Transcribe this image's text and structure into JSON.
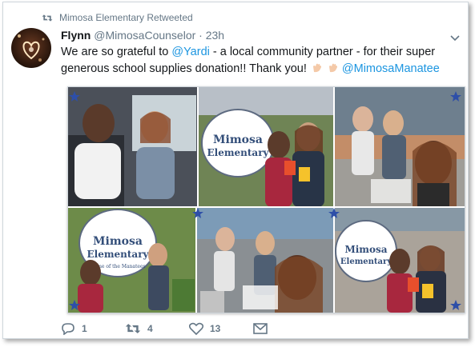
{
  "retweet": {
    "text": "Mimosa Elementary Retweeted"
  },
  "tweet": {
    "author_name": "Flynn",
    "author_handle": "@MimosaCounselor",
    "dot": "·",
    "time": "23h",
    "text_part1": "We are so grateful to ",
    "mention1": "@Yardi",
    "text_part2": " - a local community partner - for their super generous school supplies donation!! Thank you! ",
    "mention2": "@MimosaManatee"
  },
  "collage": {
    "sign_line1": "Mimosa",
    "sign_line2": "Elementary",
    "sign_line3": "Home of the Manatees"
  },
  "actions": {
    "reply_count": "1",
    "retweet_count": "4",
    "like_count": "13"
  },
  "colors": {
    "link": "#1b95e0",
    "muted": "#657786",
    "text": "#14171a"
  },
  "icons": [
    "retweet-icon",
    "chevron-down-icon",
    "clap-icon",
    "star-icon",
    "reply-icon",
    "like-icon",
    "message-icon"
  ]
}
